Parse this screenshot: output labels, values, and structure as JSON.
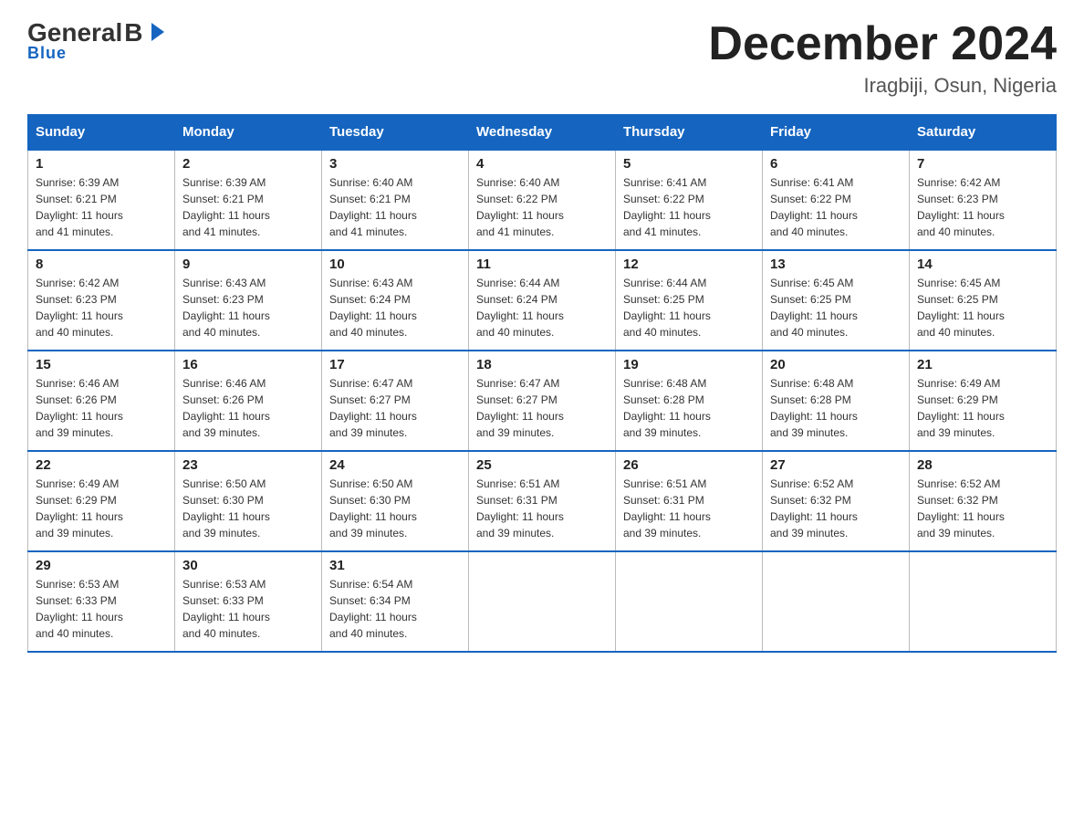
{
  "logo": {
    "general": "General",
    "blue": "Blue",
    "underline": "Blue"
  },
  "header": {
    "title": "December 2024",
    "subtitle": "Iragbiji, Osun, Nigeria"
  },
  "weekdays": [
    "Sunday",
    "Monday",
    "Tuesday",
    "Wednesday",
    "Thursday",
    "Friday",
    "Saturday"
  ],
  "weeks": [
    [
      {
        "day": "1",
        "sunrise": "6:39 AM",
        "sunset": "6:21 PM",
        "daylight": "11 hours and 41 minutes."
      },
      {
        "day": "2",
        "sunrise": "6:39 AM",
        "sunset": "6:21 PM",
        "daylight": "11 hours and 41 minutes."
      },
      {
        "day": "3",
        "sunrise": "6:40 AM",
        "sunset": "6:21 PM",
        "daylight": "11 hours and 41 minutes."
      },
      {
        "day": "4",
        "sunrise": "6:40 AM",
        "sunset": "6:22 PM",
        "daylight": "11 hours and 41 minutes."
      },
      {
        "day": "5",
        "sunrise": "6:41 AM",
        "sunset": "6:22 PM",
        "daylight": "11 hours and 41 minutes."
      },
      {
        "day": "6",
        "sunrise": "6:41 AM",
        "sunset": "6:22 PM",
        "daylight": "11 hours and 40 minutes."
      },
      {
        "day": "7",
        "sunrise": "6:42 AM",
        "sunset": "6:23 PM",
        "daylight": "11 hours and 40 minutes."
      }
    ],
    [
      {
        "day": "8",
        "sunrise": "6:42 AM",
        "sunset": "6:23 PM",
        "daylight": "11 hours and 40 minutes."
      },
      {
        "day": "9",
        "sunrise": "6:43 AM",
        "sunset": "6:23 PM",
        "daylight": "11 hours and 40 minutes."
      },
      {
        "day": "10",
        "sunrise": "6:43 AM",
        "sunset": "6:24 PM",
        "daylight": "11 hours and 40 minutes."
      },
      {
        "day": "11",
        "sunrise": "6:44 AM",
        "sunset": "6:24 PM",
        "daylight": "11 hours and 40 minutes."
      },
      {
        "day": "12",
        "sunrise": "6:44 AM",
        "sunset": "6:25 PM",
        "daylight": "11 hours and 40 minutes."
      },
      {
        "day": "13",
        "sunrise": "6:45 AM",
        "sunset": "6:25 PM",
        "daylight": "11 hours and 40 minutes."
      },
      {
        "day": "14",
        "sunrise": "6:45 AM",
        "sunset": "6:25 PM",
        "daylight": "11 hours and 40 minutes."
      }
    ],
    [
      {
        "day": "15",
        "sunrise": "6:46 AM",
        "sunset": "6:26 PM",
        "daylight": "11 hours and 39 minutes."
      },
      {
        "day": "16",
        "sunrise": "6:46 AM",
        "sunset": "6:26 PM",
        "daylight": "11 hours and 39 minutes."
      },
      {
        "day": "17",
        "sunrise": "6:47 AM",
        "sunset": "6:27 PM",
        "daylight": "11 hours and 39 minutes."
      },
      {
        "day": "18",
        "sunrise": "6:47 AM",
        "sunset": "6:27 PM",
        "daylight": "11 hours and 39 minutes."
      },
      {
        "day": "19",
        "sunrise": "6:48 AM",
        "sunset": "6:28 PM",
        "daylight": "11 hours and 39 minutes."
      },
      {
        "day": "20",
        "sunrise": "6:48 AM",
        "sunset": "6:28 PM",
        "daylight": "11 hours and 39 minutes."
      },
      {
        "day": "21",
        "sunrise": "6:49 AM",
        "sunset": "6:29 PM",
        "daylight": "11 hours and 39 minutes."
      }
    ],
    [
      {
        "day": "22",
        "sunrise": "6:49 AM",
        "sunset": "6:29 PM",
        "daylight": "11 hours and 39 minutes."
      },
      {
        "day": "23",
        "sunrise": "6:50 AM",
        "sunset": "6:30 PM",
        "daylight": "11 hours and 39 minutes."
      },
      {
        "day": "24",
        "sunrise": "6:50 AM",
        "sunset": "6:30 PM",
        "daylight": "11 hours and 39 minutes."
      },
      {
        "day": "25",
        "sunrise": "6:51 AM",
        "sunset": "6:31 PM",
        "daylight": "11 hours and 39 minutes."
      },
      {
        "day": "26",
        "sunrise": "6:51 AM",
        "sunset": "6:31 PM",
        "daylight": "11 hours and 39 minutes."
      },
      {
        "day": "27",
        "sunrise": "6:52 AM",
        "sunset": "6:32 PM",
        "daylight": "11 hours and 39 minutes."
      },
      {
        "day": "28",
        "sunrise": "6:52 AM",
        "sunset": "6:32 PM",
        "daylight": "11 hours and 39 minutes."
      }
    ],
    [
      {
        "day": "29",
        "sunrise": "6:53 AM",
        "sunset": "6:33 PM",
        "daylight": "11 hours and 40 minutes."
      },
      {
        "day": "30",
        "sunrise": "6:53 AM",
        "sunset": "6:33 PM",
        "daylight": "11 hours and 40 minutes."
      },
      {
        "day": "31",
        "sunrise": "6:54 AM",
        "sunset": "6:34 PM",
        "daylight": "11 hours and 40 minutes."
      },
      null,
      null,
      null,
      null
    ]
  ],
  "labels": {
    "sunrise": "Sunrise:",
    "sunset": "Sunset:",
    "daylight": "Daylight:"
  }
}
